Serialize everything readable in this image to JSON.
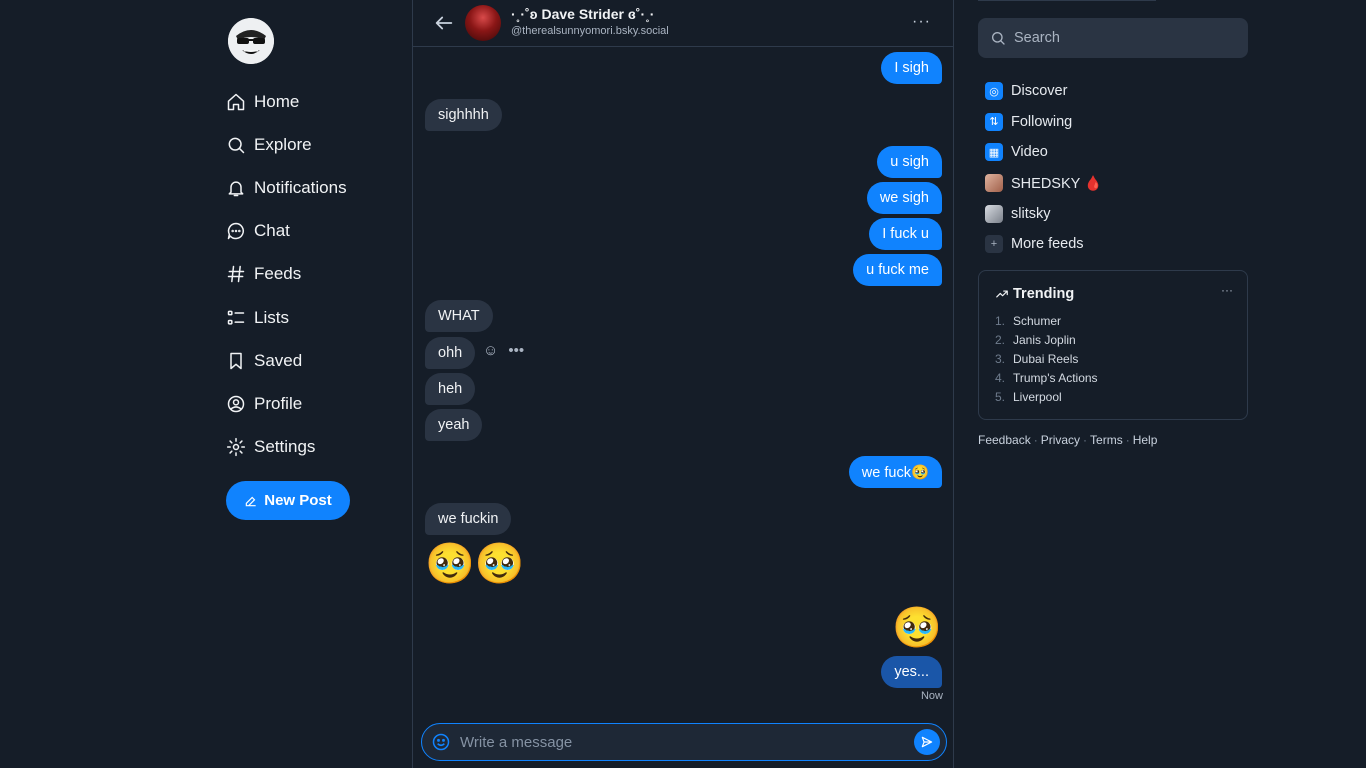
{
  "nav": {
    "items": [
      {
        "label": "Home",
        "icon": "home-icon"
      },
      {
        "label": "Explore",
        "icon": "search-icon"
      },
      {
        "label": "Notifications",
        "icon": "bell-icon"
      },
      {
        "label": "Chat",
        "icon": "chat-icon"
      },
      {
        "label": "Feeds",
        "icon": "hash-icon"
      },
      {
        "label": "Lists",
        "icon": "list-icon"
      },
      {
        "label": "Saved",
        "icon": "bookmark-icon"
      },
      {
        "label": "Profile",
        "icon": "user-circle-icon"
      },
      {
        "label": "Settings",
        "icon": "gear-icon"
      }
    ],
    "new_post": "New Post"
  },
  "chat": {
    "name": "·˳·˚ʚ Dave Strider ɞ˚·˳·",
    "handle": "@therealsunnyomori.bsky.social",
    "more": "···",
    "messages": [
      {
        "from": "me",
        "text": "I sigh"
      },
      {
        "from": "them",
        "text": "sighhhh"
      },
      {
        "from": "me",
        "text": "u sigh"
      },
      {
        "from": "me",
        "text": "we sigh"
      },
      {
        "from": "me",
        "text": "I fuck u"
      },
      {
        "from": "me",
        "text": "u fuck me"
      },
      {
        "from": "them",
        "text": "WHAT"
      },
      {
        "from": "them",
        "text": "ohh"
      },
      {
        "from": "them",
        "text": "heh"
      },
      {
        "from": "them",
        "text": "yeah"
      },
      {
        "from": "me",
        "text": "we fuck🥹"
      },
      {
        "from": "them",
        "text": "we fuckin"
      },
      {
        "from": "them",
        "text": "🥹🥹"
      },
      {
        "from": "me",
        "text": "🥹"
      },
      {
        "from": "me",
        "text": "yes..."
      }
    ],
    "timestamp": "Now",
    "composer_placeholder": "Write a message"
  },
  "sidebar": {
    "search_placeholder": "Search",
    "feeds": [
      {
        "label": "Discover",
        "icon": "discover-icon",
        "color": "#1083fe"
      },
      {
        "label": "Following",
        "icon": "following-icon",
        "color": "#1083fe"
      },
      {
        "label": "Video",
        "icon": "video-icon",
        "color": "#1083fe"
      },
      {
        "label": "SHEDSKY 🩸",
        "icon": "shedsky-avatar",
        "color": "#c98a6b"
      },
      {
        "label": "slitsky",
        "icon": "slitsky-avatar",
        "color": "#9aa1ad"
      },
      {
        "label": "More feeds",
        "icon": "plus-icon",
        "color": "#2a3443"
      }
    ],
    "trending": {
      "title": "Trending",
      "items": [
        {
          "num": "1.",
          "topic": "Schumer"
        },
        {
          "num": "2.",
          "topic": "Janis Joplin"
        },
        {
          "num": "3.",
          "topic": "Dubai Reels"
        },
        {
          "num": "4.",
          "topic": "Trump's Actions"
        },
        {
          "num": "5.",
          "topic": "Liverpool"
        }
      ]
    },
    "footer": [
      "Feedback",
      "Privacy",
      "Terms",
      "Help"
    ]
  },
  "colors": {
    "accent": "#1083fe",
    "background": "#151d28",
    "bubble_other": "#2a3443"
  }
}
